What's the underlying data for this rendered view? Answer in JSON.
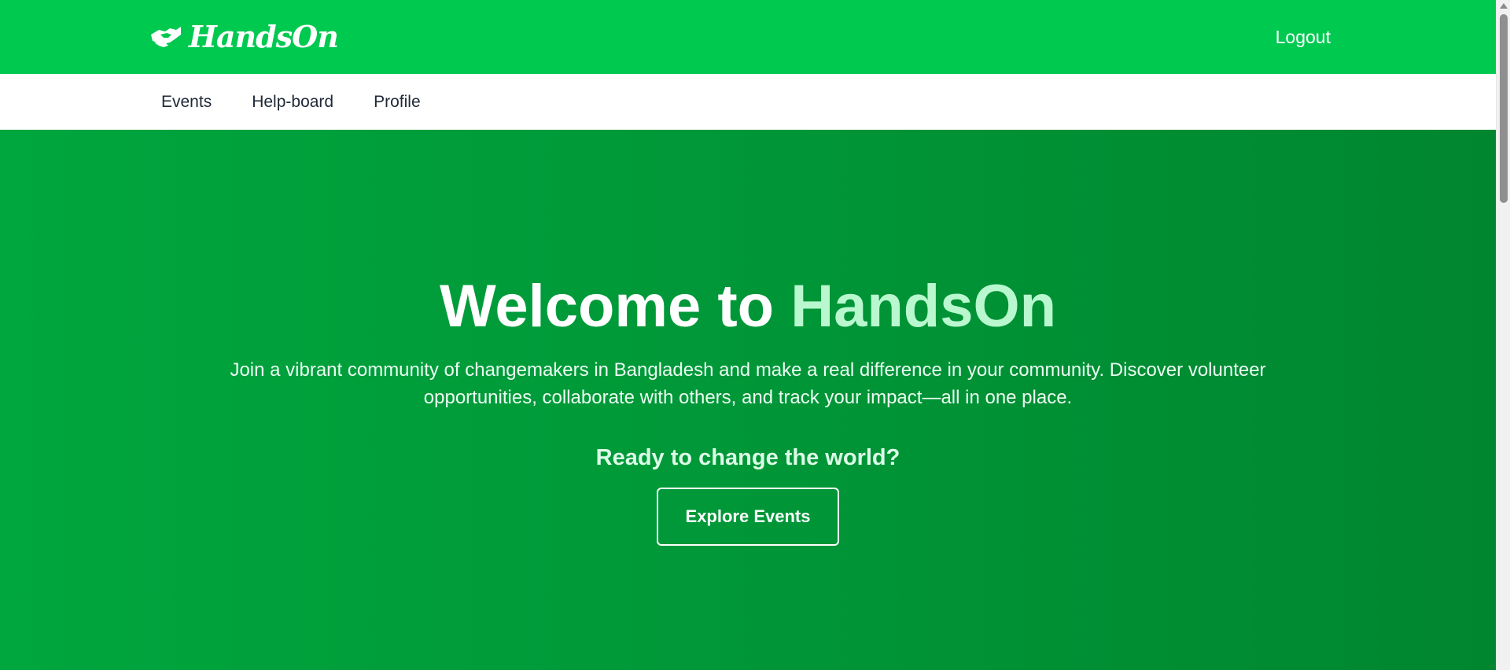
{
  "header": {
    "brand_name": "HandsOn",
    "brand_icon": "handshake-icon",
    "logout_label": "Logout",
    "background_color": "#00c950"
  },
  "nav": {
    "items": [
      {
        "label": "Events"
      },
      {
        "label": "Help-board"
      },
      {
        "label": "Profile"
      }
    ]
  },
  "hero": {
    "title_prefix": "Welcome to ",
    "title_accent": "HandsOn",
    "description": "Join a vibrant community of changemakers in Bangladesh and make a real difference in your community. Discover volunteer opportunities, collaborate with others, and track your impact—all in one place.",
    "cta_label": "Ready to change the world?",
    "button_label": "Explore Events",
    "accent_color": "#b9f8cf",
    "gradient_colors": [
      "#00a63e",
      "#00862f"
    ]
  }
}
